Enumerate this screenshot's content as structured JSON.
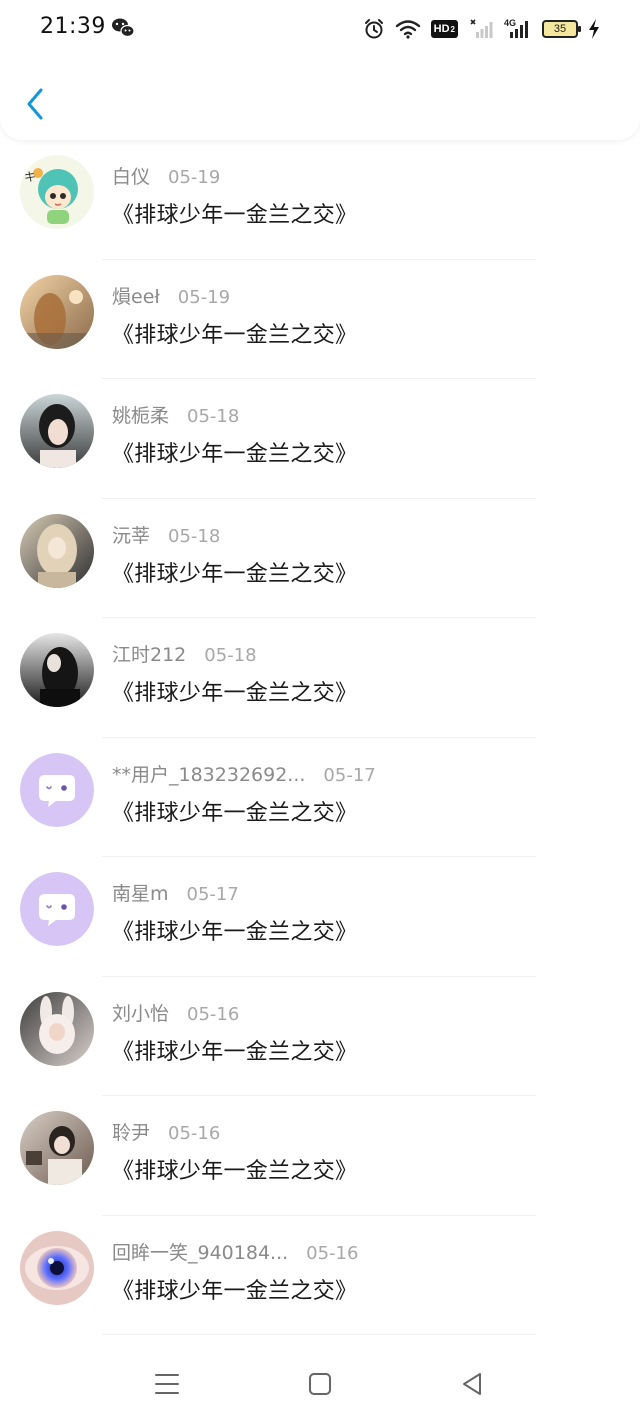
{
  "status_bar": {
    "time": "21:39",
    "left_icons": [
      "wechat-icon"
    ],
    "right_icons": [
      "alarm-icon",
      "wifi-icon",
      "hd-icon",
      "signal-icon",
      "signal-4g-icon",
      "battery-icon",
      "charging-icon"
    ],
    "hd_label": "HD",
    "hd_sub": "2",
    "net_label": "4G",
    "battery": "35"
  },
  "header": {
    "back_icon": "chevron-left-icon",
    "accent": "#1296db"
  },
  "list": {
    "items": [
      {
        "user": "白仪",
        "date": "05-19",
        "title": "《排球少年一金兰之交》",
        "avatar": "avatar-cartoon"
      },
      {
        "user": "熉eeł",
        "date": "05-19",
        "title": "《排球少年一金兰之交》",
        "avatar": "avatar-photo"
      },
      {
        "user": "姚栀柔",
        "date": "05-18",
        "title": "《排球少年一金兰之交》",
        "avatar": "avatar-photo"
      },
      {
        "user": "沅莘",
        "date": "05-18",
        "title": "《排球少年一金兰之交》",
        "avatar": "avatar-photo"
      },
      {
        "user": "江时212",
        "date": "05-18",
        "title": "《排球少年一金兰之交》",
        "avatar": "avatar-photo"
      },
      {
        "user": "**用户_183232692...",
        "date": "05-17",
        "title": "《排球少年一金兰之交》",
        "avatar": "default-chat-avatar"
      },
      {
        "user": "南星m",
        "date": "05-17",
        "title": "《排球少年一金兰之交》",
        "avatar": "default-chat-avatar"
      },
      {
        "user": "刘小怡",
        "date": "05-16",
        "title": "《排球少年一金兰之交》",
        "avatar": "avatar-photo"
      },
      {
        "user": "聆尹",
        "date": "05-16",
        "title": "《排球少年一金兰之交》",
        "avatar": "avatar-photo"
      },
      {
        "user": "回眸一笑_940184...",
        "date": "05-16",
        "title": "《排球少年一金兰之交》",
        "avatar": "avatar-eye"
      }
    ]
  },
  "nav_bar": {
    "icons": [
      "menu-icon",
      "home-square-icon",
      "back-triangle-icon"
    ]
  },
  "colors": {
    "default_avatar": "#d7c6f5",
    "name_gray": "#8a8a8a",
    "title_dark": "#1a1a1a"
  }
}
